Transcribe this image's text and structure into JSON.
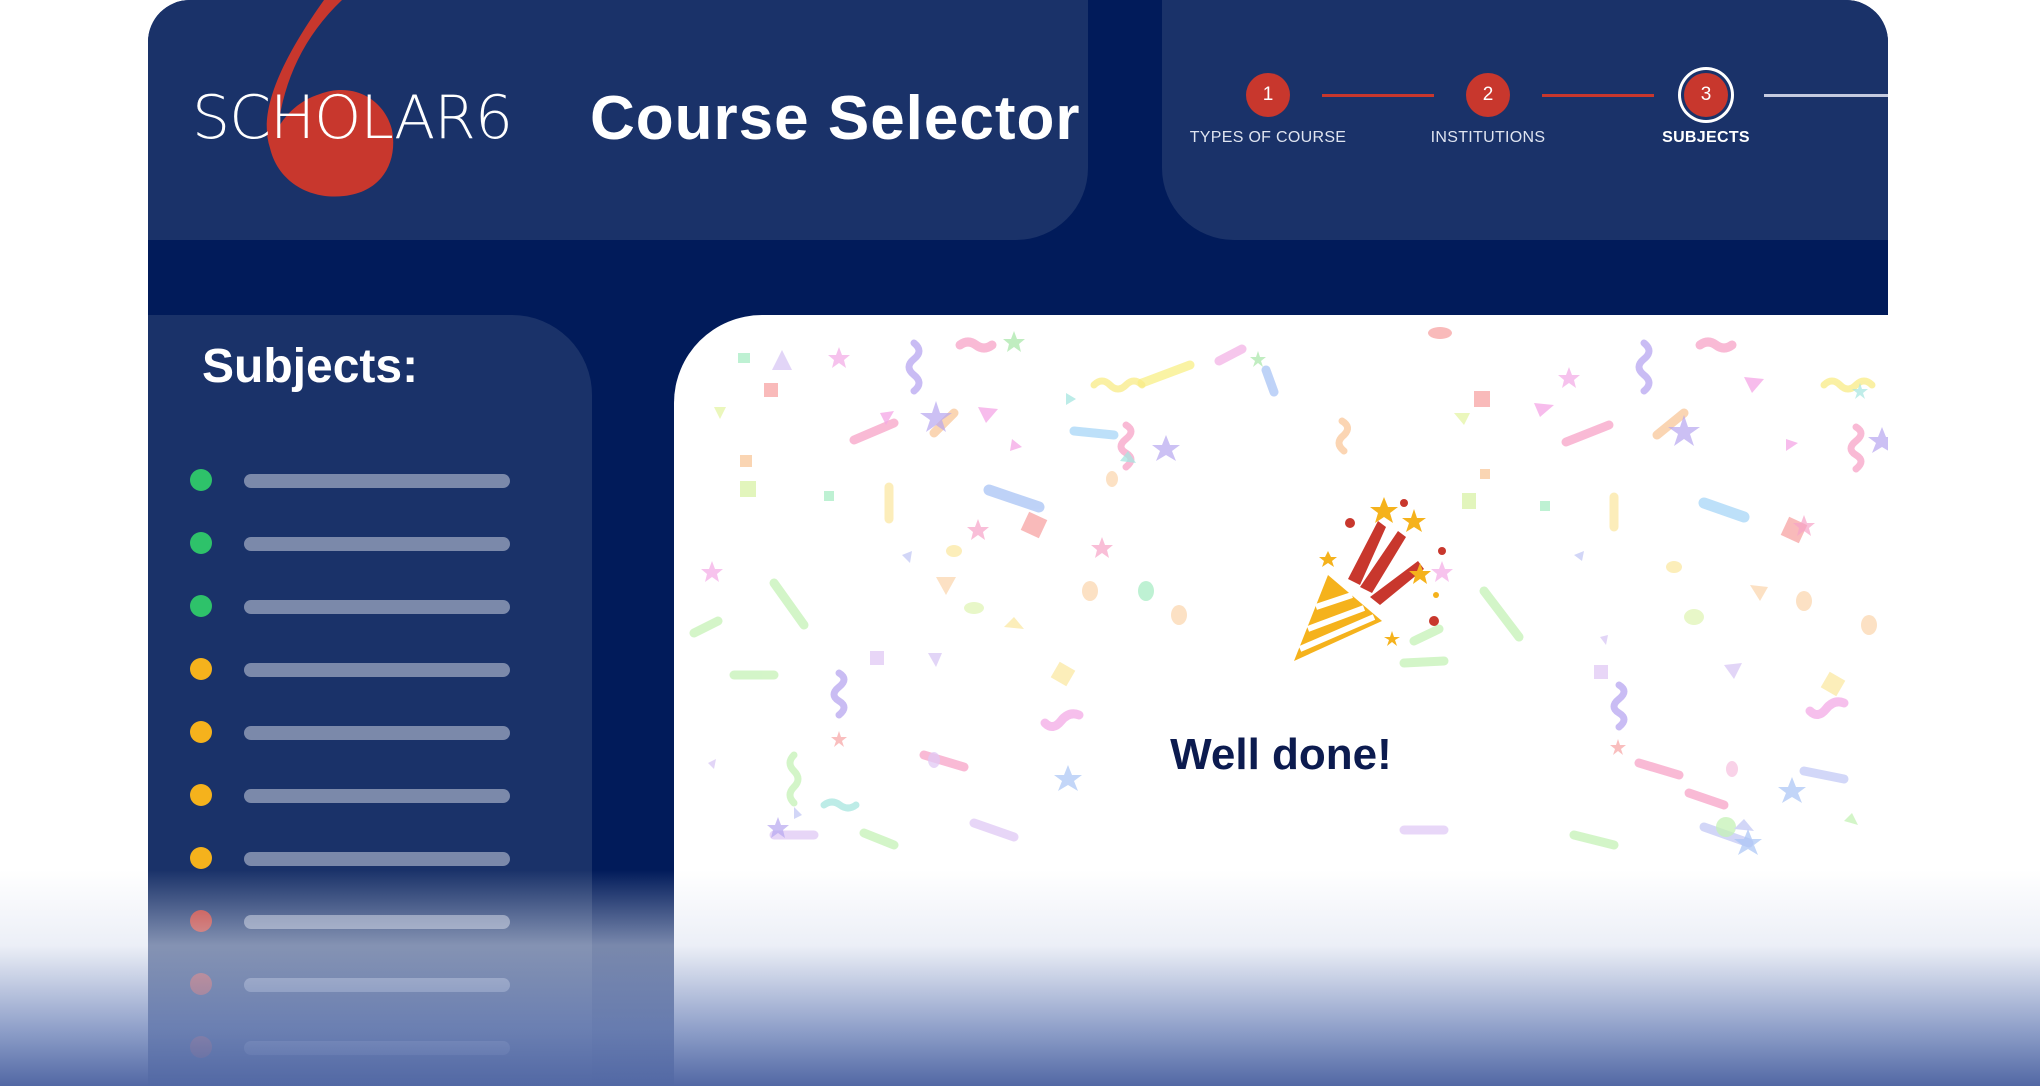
{
  "brand": {
    "logo_text": "SCHOLAR6",
    "logo_numeral": "6",
    "app_title": "Course Selector",
    "colors": {
      "navy_bg": "#011b5a",
      "panel": "#1a3269",
      "accent_red": "#c8372d",
      "green": "#2ec26a",
      "amber": "#f5b21c",
      "red": "#c8372d"
    }
  },
  "stepper": {
    "steps": [
      {
        "number": "1",
        "label": "TYPES OF COURSE",
        "state": "complete"
      },
      {
        "number": "2",
        "label": "INSTITUTIONS",
        "state": "complete"
      },
      {
        "number": "3",
        "label": "SUBJECTS",
        "state": "current"
      }
    ]
  },
  "sidebar": {
    "title": "Subjects:",
    "items": [
      {
        "status": "green"
      },
      {
        "status": "green"
      },
      {
        "status": "green"
      },
      {
        "status": "amber"
      },
      {
        "status": "amber"
      },
      {
        "status": "amber"
      },
      {
        "status": "amber"
      },
      {
        "status": "red"
      },
      {
        "status": "red"
      },
      {
        "status": "red"
      }
    ]
  },
  "main": {
    "icon": "party-popper-icon",
    "message": "Well done!"
  }
}
